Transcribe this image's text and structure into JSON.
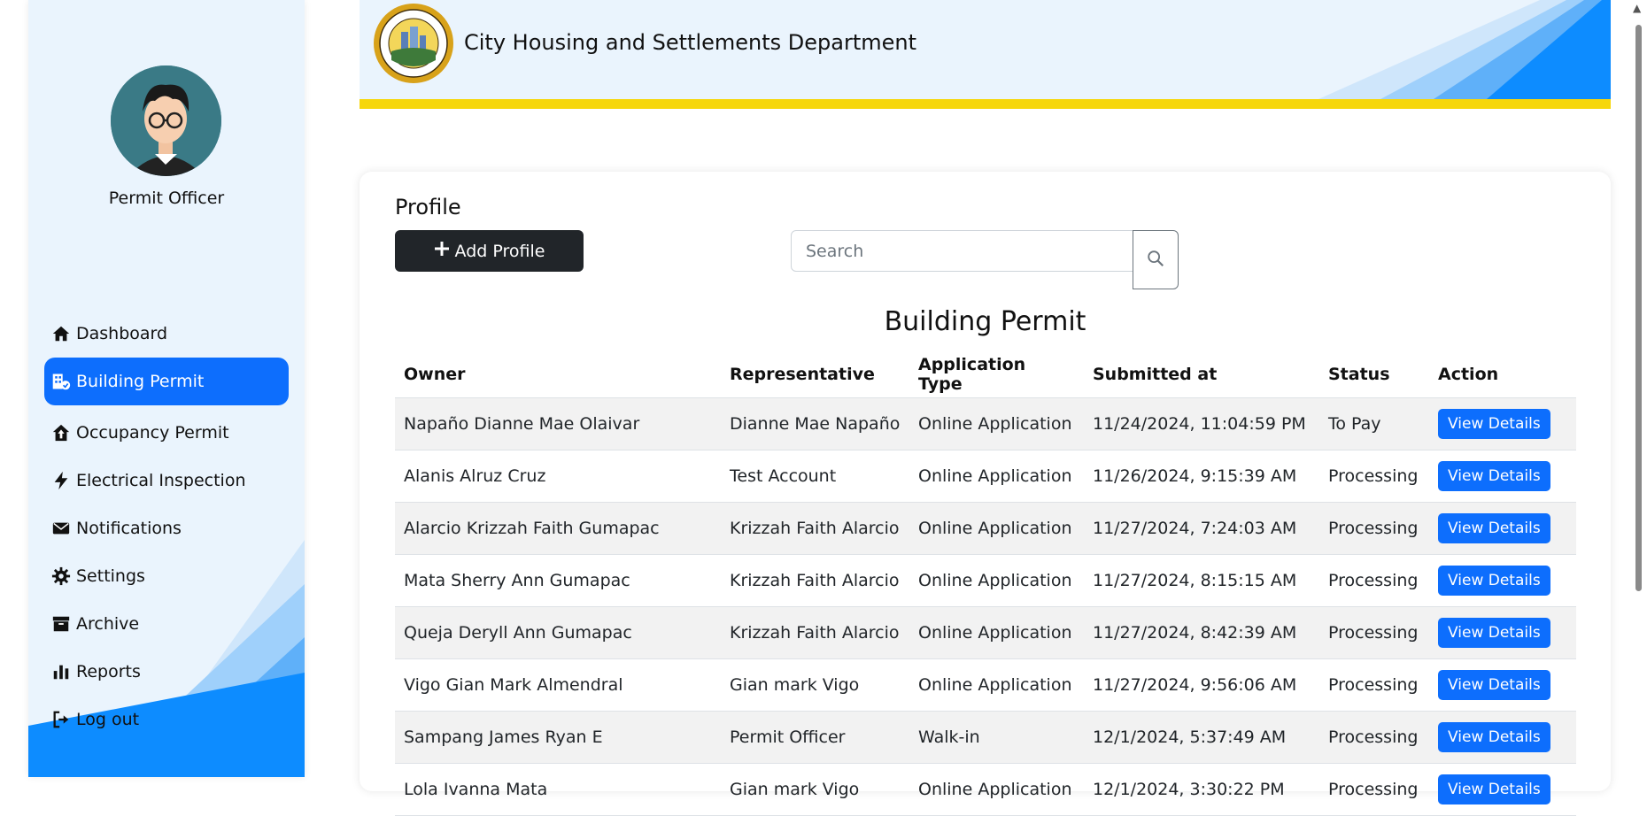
{
  "header": {
    "title": "City Housing and Settlements Department",
    "logo_text": "CITY HOUSING AND SETTLEMENTS DEPARTMENT • CITY OF CALAMBA"
  },
  "sidebar": {
    "role": "Permit Officer",
    "items": [
      {
        "label": "Dashboard",
        "icon": "home-icon"
      },
      {
        "label": "Building Permit",
        "icon": "building-icon",
        "active": true
      },
      {
        "label": "Occupancy Permit",
        "icon": "house-up-icon"
      },
      {
        "label": "Electrical Inspection",
        "icon": "bolt-icon"
      },
      {
        "label": "Notifications",
        "icon": "envelope-icon"
      },
      {
        "label": "Settings",
        "icon": "gear-icon"
      },
      {
        "label": "Archive",
        "icon": "archive-icon"
      },
      {
        "label": "Reports",
        "icon": "chart-bar-icon"
      },
      {
        "label": "Log out",
        "icon": "logout-icon"
      }
    ]
  },
  "main": {
    "section_title": "Profile",
    "add_button": "Add Profile",
    "search": {
      "placeholder": "Search",
      "value": ""
    },
    "table_title": "Building Permit",
    "columns": [
      "Owner",
      "Representative",
      "Application Type",
      "Submitted at",
      "Status",
      "Action"
    ],
    "action_label": "View Details",
    "rows": [
      [
        "Napaño Dianne Mae Olaivar",
        "Dianne Mae Napaño",
        "Online Application",
        "11/24/2024, 11:04:59 PM",
        "To Pay"
      ],
      [
        "Alanis Alruz Cruz",
        "Test Account",
        "Online Application",
        "11/26/2024, 9:15:39 AM",
        "Processing"
      ],
      [
        "Alarcio Krizzah Faith Gumapac",
        "Krizzah Faith Alarcio",
        "Online Application",
        "11/27/2024, 7:24:03 AM",
        "Processing"
      ],
      [
        "Mata Sherry Ann Gumapac",
        "Krizzah Faith Alarcio",
        "Online Application",
        "11/27/2024, 8:15:15 AM",
        "Processing"
      ],
      [
        "Queja Deryll Ann Gumapac",
        "Krizzah Faith Alarcio",
        "Online Application",
        "11/27/2024, 8:42:39 AM",
        "Processing"
      ],
      [
        "Vigo Gian Mark Almendral",
        "Gian mark Vigo",
        "Online Application",
        "11/27/2024, 9:56:06 AM",
        "Processing"
      ],
      [
        "Sampang James Ryan E",
        "Permit Officer",
        "Walk-in",
        "12/1/2024, 5:37:49 AM",
        "Processing"
      ],
      [
        "Lola Ivanna Mata",
        "Gian mark Vigo",
        "Online Application",
        "12/1/2024, 3:30:22 PM",
        "Processing"
      ]
    ]
  },
  "colors": {
    "accent": "#0d6efd",
    "header_bg": "#eaf4fd",
    "yellow": "#f6d70b",
    "dark_button": "#212529"
  }
}
